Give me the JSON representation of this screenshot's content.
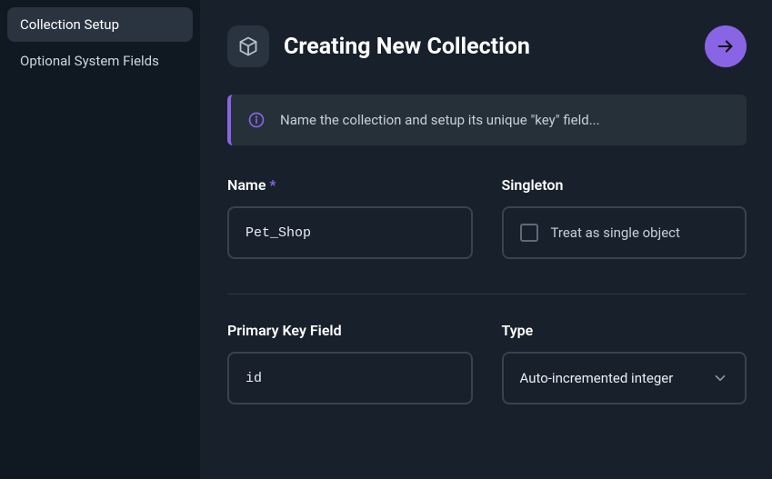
{
  "sidebar": {
    "items": [
      {
        "label": "Collection Setup",
        "active": true
      },
      {
        "label": "Optional System Fields",
        "active": false
      }
    ]
  },
  "header": {
    "title": "Creating New Collection"
  },
  "banner": {
    "text": "Name the collection and setup its unique \"key\" field..."
  },
  "fields": {
    "name": {
      "label": "Name",
      "required_mark": "*",
      "value": "Pet_Shop"
    },
    "singleton": {
      "label": "Singleton",
      "option_text": "Treat as single object"
    },
    "primary_key": {
      "label": "Primary Key Field",
      "value": "id"
    },
    "type": {
      "label": "Type",
      "selected": "Auto-incremented integer"
    }
  }
}
